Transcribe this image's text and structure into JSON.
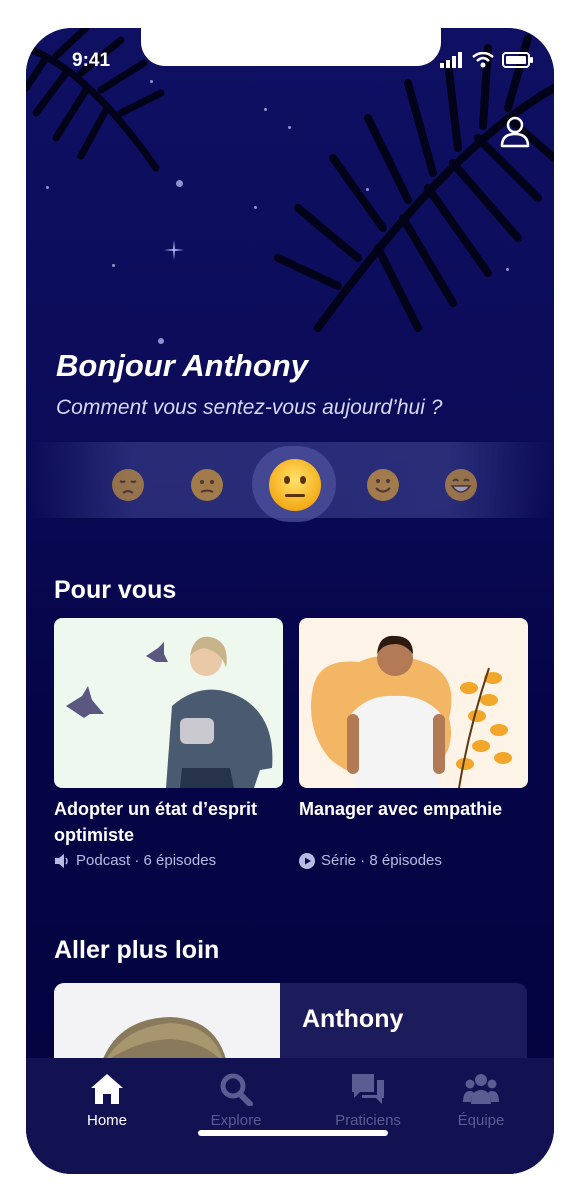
{
  "status": {
    "time": "9:41"
  },
  "header": {
    "greeting": "Bonjour Anthony",
    "question": "Comment vous sentez-vous aujourd’hui ?"
  },
  "moods": [
    "sad-emoji",
    "confused-emoji",
    "neutral-emoji",
    "smile-emoji",
    "grin-emoji"
  ],
  "selected_mood": "neutral-emoji",
  "for_you": {
    "title": "Pour vous",
    "cards": [
      {
        "title": "Adopter un état d’esprit optimiste",
        "meta_icon": "speaker-icon",
        "meta": "Podcast · 6 épisodes"
      },
      {
        "title": "Manager avec empathie",
        "meta_icon": "play-icon",
        "meta": "Série · 8 épisodes"
      }
    ]
  },
  "go_further": {
    "title": "Aller plus loin",
    "card_name": "Anthony"
  },
  "tabs": [
    {
      "label": "Home",
      "icon": "home-icon",
      "active": true
    },
    {
      "label": "Explore",
      "icon": "search-icon",
      "active": false
    },
    {
      "label": "Praticiens",
      "icon": "chat-icon",
      "active": false
    },
    {
      "label": "Équipe",
      "icon": "team-icon",
      "active": false
    }
  ],
  "colors": {
    "background": "#07064a",
    "tabbar": "#121152",
    "accent_card1": "#eef8ee",
    "accent_card2": "#fdf3e6"
  }
}
